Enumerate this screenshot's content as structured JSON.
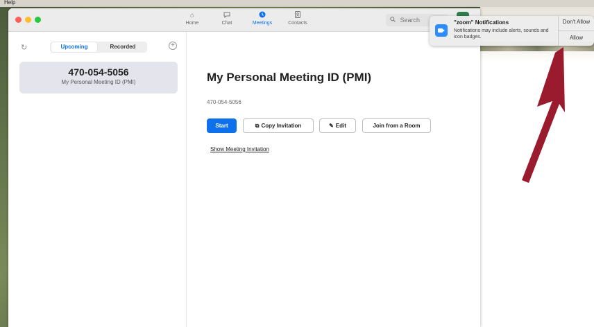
{
  "menubar": {
    "app_label": "Help"
  },
  "nav": {
    "home": "Home",
    "chat": "Chat",
    "meetings": "Meetings",
    "contacts": "Contacts"
  },
  "search": {
    "placeholder": "Search"
  },
  "sidebar": {
    "tabs": {
      "upcoming": "Upcoming",
      "recorded": "Recorded"
    },
    "meeting": {
      "id": "470-054-5056",
      "label": "My Personal Meeting ID (PMI)"
    }
  },
  "main": {
    "title": "My Personal Meeting ID (PMI)",
    "meeting_id": "470-054-5056",
    "buttons": {
      "start": "Start",
      "copy": "Copy Invitation",
      "edit": "Edit",
      "join": "Join from a Room"
    },
    "show_invitation": "Show Meeting Invitation"
  },
  "notification": {
    "title": "\"zoom\" Notifications",
    "body": "Notifications may include alerts, sounds and icon badges.",
    "dont_allow": "Don't Allow",
    "allow": "Allow"
  },
  "colors": {
    "accent": "#0e71eb",
    "arrow": "#9b1b2e"
  }
}
